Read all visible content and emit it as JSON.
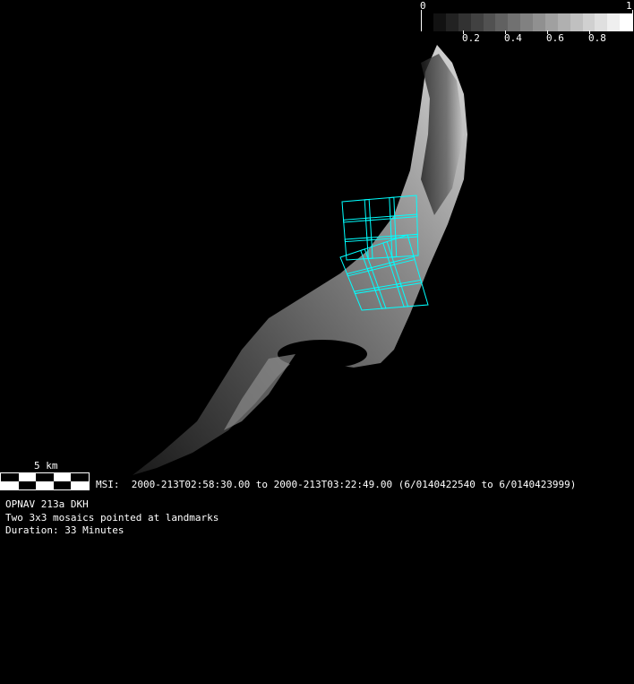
{
  "colorbar": {
    "min_label": "0",
    "max_label": "1",
    "tick_labels": [
      "0.2",
      "0.4",
      "0.6",
      "0.8"
    ],
    "steps": 16
  },
  "scale_bar": {
    "label": "5 km"
  },
  "msi_line": "MSI:  2000-213T02:58:30.00 to 2000-213T03:22:49.00 (6/0140422540 to 6/0140423999)",
  "info": {
    "title": "OPNAV 213a DKH",
    "description": "Two 3x3 mosaics pointed at landmarks",
    "duration": "Duration: 33 Minutes"
  },
  "colors": {
    "footprint": "#00ffff",
    "background": "#000000"
  }
}
